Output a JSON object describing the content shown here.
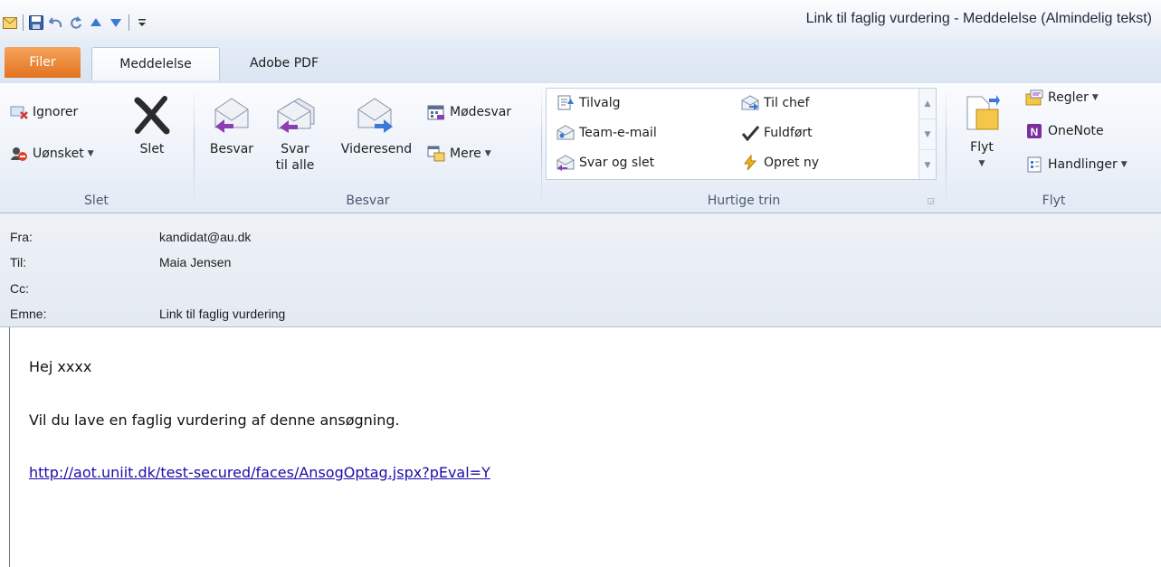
{
  "window": {
    "title": "Link til faglig vurdering  -  Meddelelse (Almindelig tekst)"
  },
  "qat": {
    "icons": [
      "mail-icon",
      "save-icon",
      "undo-icon",
      "redo-icon",
      "up-arrow-icon",
      "down-arrow-icon",
      "customize-icon"
    ]
  },
  "tabs": {
    "file": "Filer",
    "message": "Meddelelse",
    "adobe": "Adobe PDF"
  },
  "ribbon": {
    "slet": {
      "label": "Slet",
      "ignorer": "Ignorer",
      "uonsket": "Uønsket",
      "slet_btn": "Slet"
    },
    "besvar": {
      "label": "Besvar",
      "besvar_btn": "Besvar",
      "svar_line1": "Svar",
      "svar_line2": "til alle",
      "videresend": "Videresend",
      "modesvar": "Mødesvar",
      "mere": "Mere"
    },
    "hurtige": {
      "label": "Hurtige trin",
      "tilvalg": "Tilvalg",
      "team": "Team-e-mail",
      "svar_slet": "Svar og slet",
      "til_chef": "Til chef",
      "fuldfort": "Fuldført",
      "opret": "Opret ny"
    },
    "flyt": {
      "label": "Flyt",
      "flyt_btn": "Flyt",
      "regler": "Regler",
      "onenote": "OneNote",
      "handlinger": "Handlinger"
    }
  },
  "header": {
    "from_label": "Fra:",
    "from_value": "kandidat@au.dk",
    "to_label": "Til:",
    "to_value": "Maia Jensen",
    "cc_label": "Cc:",
    "cc_value": "",
    "subject_label": "Emne:",
    "subject_value": "Link til faglig vurdering"
  },
  "body": {
    "greeting": "Hej xxxx",
    "line1": "Vil du lave en faglig vurdering af denne ansøgning.",
    "link": "http://aot.uniit.dk/test-secured/faces/AnsogOptag.jspx?pEval=Y"
  }
}
